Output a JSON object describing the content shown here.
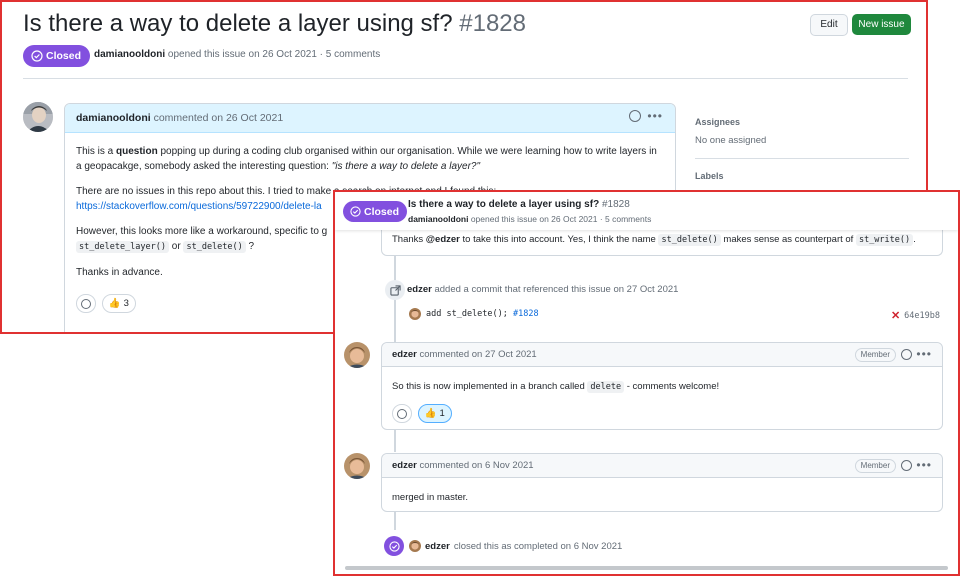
{
  "issue": {
    "title": "Is there a way to delete a layer using sf?",
    "number": "#1828",
    "status": "Closed",
    "author": "damianooldoni",
    "meta_suffix": "opened this issue on 26 Oct 2021 · 5 comments",
    "meta_suffix_short": "opened this issue on 26 Oct 2021 · 5 comments"
  },
  "buttons": {
    "edit": "Edit",
    "new_issue": "New issue"
  },
  "first_comment": {
    "author": "damianooldoni",
    "date": "commented on 26 Oct 2021",
    "p1_pre": "This is a ",
    "p1_bold": "question",
    "p1_mid": " popping up during a coding club organised within our organisation. While we were learning how to write layers in a geopacakge, somebody asked the interesting question: ",
    "p1_quote": "\"is there a way to delete a layer?\"",
    "p2_text": "There are no issues in this repo about this. I tried to make a search on internet and I found this:",
    "p2_link": "https://stackoverflow.com/questions/59722900/delete-la",
    "p3_text": "However, this looks more like a workaround, specific to g",
    "p3_code1": "st_delete_layer()",
    "p3_or": "or",
    "p3_code2": "st_delete()",
    "p3_q": "?",
    "p4_text": "Thanks in advance.",
    "reaction_count": "3"
  },
  "sidebar": {
    "assignees_label": "Assignees",
    "assignees_value": "No one assigned",
    "labels_label": "Labels"
  },
  "timeline": {
    "top_text_pre": "Thanks ",
    "top_mention": "@edzer",
    "top_text_mid": " to take this into account. Yes, I think the name ",
    "top_code1": "st_delete()",
    "top_text_mid2": " makes sense as counterpart of ",
    "top_code2": "st_write()",
    "top_text_end": ".",
    "commit_event_user": "edzer",
    "commit_event_text": "added a commit that referenced this issue on 27 Oct 2021",
    "commit_msg": "add st_delete(); ",
    "commit_ref": "#1828",
    "commit_sha": "64e19b8",
    "comment2_author": "edzer",
    "comment2_date": "commented on 27 Oct 2021",
    "comment2_role": "Member",
    "comment2_pre": "So this is now implemented in a branch called ",
    "comment2_code": "delete",
    "comment2_post": " - comments welcome!",
    "comment2_reaction_count": "1",
    "comment3_author": "edzer",
    "comment3_date": "commented on 6 Nov 2021",
    "comment3_role": "Member",
    "comment3_text": "merged in master.",
    "closed_user": "edzer",
    "closed_text": "closed this as completed on 6 Nov 2021"
  },
  "colors": {
    "closed_purple": "#8250df",
    "primary_green": "#1f883d",
    "highlight_border": "#e03131",
    "link_blue": "#0969da"
  }
}
